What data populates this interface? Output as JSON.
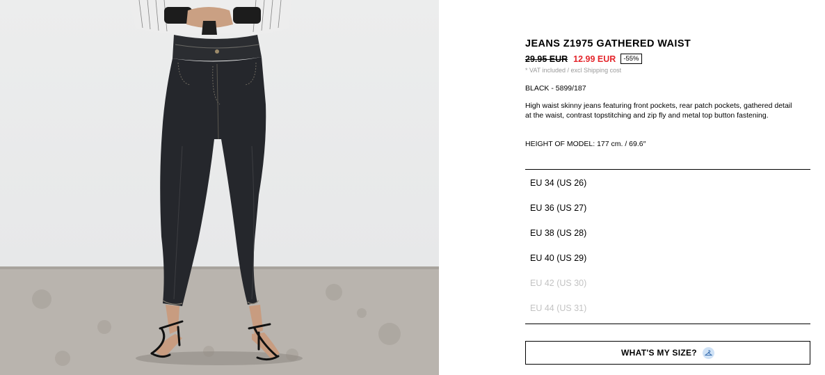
{
  "product": {
    "title": "JEANS Z1975 GATHERED WAIST",
    "old_price": "29.95 EUR",
    "new_price": "12.99 EUR",
    "discount": "-55%",
    "vat_note": "* VAT included / excl Shipping cost",
    "color_ref": "BLACK - 5899/187",
    "description": "High waist skinny jeans featuring front pockets, rear patch pockets, gathered detail at the waist, contrast topstitching and zip fly and metal top button fastening.",
    "model_height": "HEIGHT OF MODEL: 177 cm. / 69.6″"
  },
  "sizes": [
    {
      "label": "EU 34 (US 26)",
      "available": true
    },
    {
      "label": "EU 36 (US 27)",
      "available": true
    },
    {
      "label": "EU 38 (US 28)",
      "available": true
    },
    {
      "label": "EU 40 (US 29)",
      "available": true
    },
    {
      "label": "EU 42 (US 30)",
      "available": false
    },
    {
      "label": "EU 44 (US 31)",
      "available": false
    }
  ],
  "size_button": {
    "label": "WHAT'S MY SIZE?",
    "icon": "hanger-icon"
  },
  "colors": {
    "sale": "#e4262c",
    "unavailable": "#c3c3c3",
    "icon_bg": "#cfe2f6"
  }
}
